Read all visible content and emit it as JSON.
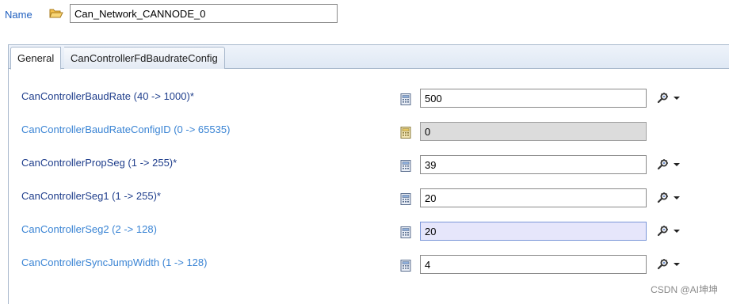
{
  "header": {
    "name_label": "Name",
    "name_value": "Can_Network_CANNODE_0"
  },
  "tabs": [
    {
      "label": "General",
      "active": true
    },
    {
      "label": "CanControllerFdBaudrateConfig",
      "active": false
    }
  ],
  "params": [
    {
      "label": "CanControllerBaudRate (40 -> 1000)*",
      "value": "500",
      "kind": "mandatory",
      "editable": true
    },
    {
      "label": "CanControllerBaudRateConfigID (0 -> 65535)",
      "value": "0",
      "kind": "optional",
      "editable": false
    },
    {
      "label": "CanControllerPropSeg (1 -> 255)*",
      "value": "39",
      "kind": "mandatory",
      "editable": true
    },
    {
      "label": "CanControllerSeg1 (1 -> 255)*",
      "value": "20",
      "kind": "mandatory",
      "editable": true
    },
    {
      "label": "CanControllerSeg2 (2 -> 128)",
      "value": "20",
      "kind": "optional",
      "editable": true,
      "focused": true
    },
    {
      "label": "CanControllerSyncJumpWidth (1 -> 128)",
      "value": "4",
      "kind": "optional",
      "editable": true
    }
  ],
  "icons": {
    "name_row": "folder-open-icon",
    "value_row": "calculator-icon",
    "action": "gear-icon"
  },
  "colors": {
    "mandatory_label": "#1f3e8c",
    "optional_label": "#3a84d4",
    "readonly_field": "#dcdcdc",
    "focused_field": "#e6e6fb"
  },
  "watermark": "CSDN @AI坤坤"
}
